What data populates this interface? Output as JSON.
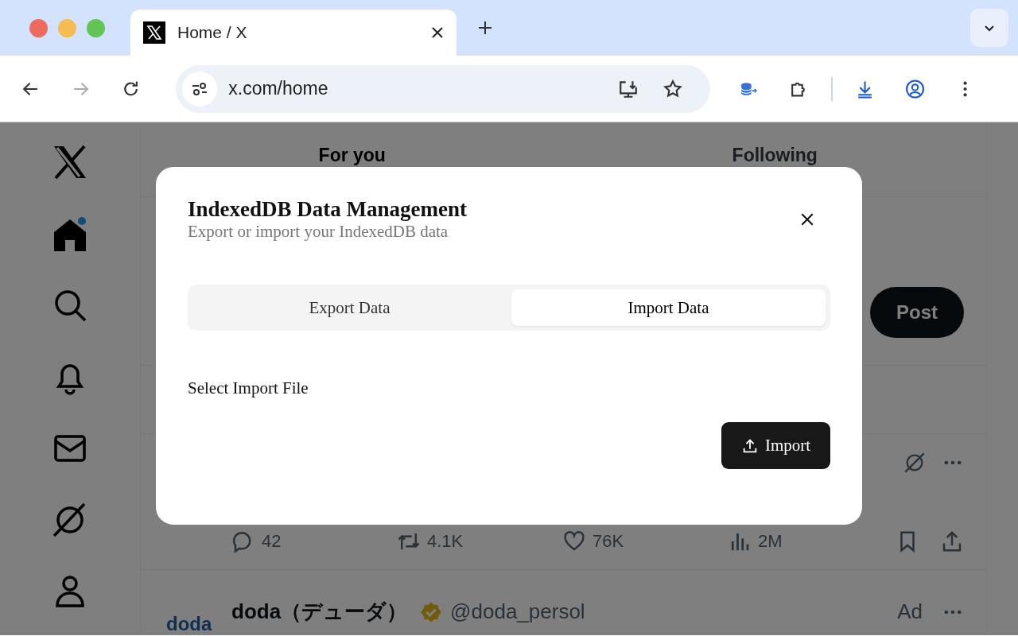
{
  "browser": {
    "tab": {
      "title": "Home / X"
    },
    "url": "x.com/home"
  },
  "feed_tabs": [
    {
      "label": "For you",
      "selected": true
    },
    {
      "label": "Following",
      "selected": false
    }
  ],
  "post_button": "Post",
  "tweet_actions": [
    {
      "kind": "reply",
      "count": "42"
    },
    {
      "kind": "repost",
      "count": "4.1K"
    },
    {
      "kind": "like",
      "count": "76K"
    },
    {
      "kind": "views",
      "count": "2M"
    }
  ],
  "ad": {
    "logo": "doda",
    "name": "doda（デューダ）",
    "handle": "@doda_persol",
    "label": "Ad"
  },
  "modal": {
    "title": "IndexedDB Data Management",
    "subtitle": "Export or import your IndexedDB data",
    "tabs": [
      {
        "label": "Export Data",
        "selected": false
      },
      {
        "label": "Import Data",
        "selected": true
      }
    ],
    "field_label": "Select Import File",
    "button": "Import"
  }
}
